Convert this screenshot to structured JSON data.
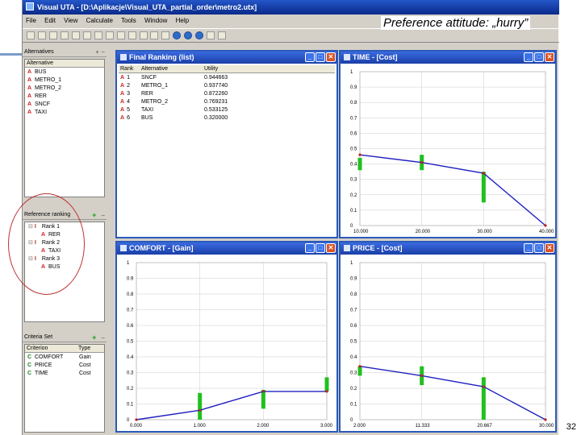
{
  "titlebar": {
    "title": "Visual UTA - [D:\\Aplikacje\\Visual_UTA_partial_order\\metro2.utx]"
  },
  "menu": [
    "File",
    "Edit",
    "View",
    "Calculate",
    "Tools",
    "Window",
    "Help"
  ],
  "overlay": {
    "preference": "Preference attitude: „hurry”",
    "slide_number": "32"
  },
  "alternatives_panel": {
    "title": "Alternatives",
    "column": "Alternative",
    "items": [
      {
        "mark": "A",
        "name": "BUS"
      },
      {
        "mark": "A",
        "name": "METRO_1"
      },
      {
        "mark": "A",
        "name": "METRO_2"
      },
      {
        "mark": "A",
        "name": "RER"
      },
      {
        "mark": "A",
        "name": "SNCF"
      },
      {
        "mark": "A",
        "name": "TAXI"
      }
    ]
  },
  "reference_panel": {
    "title": "Reference ranking",
    "tree": [
      {
        "rank": "Rank 1",
        "items": [
          "RER"
        ]
      },
      {
        "rank": "Rank 2",
        "items": [
          "TAXI"
        ]
      },
      {
        "rank": "Rank 3",
        "items": [
          "BUS"
        ]
      }
    ]
  },
  "criteria_panel": {
    "title": "Criteria Set",
    "columns": [
      "Criterion",
      "Type"
    ],
    "items": [
      {
        "mark": "C",
        "name": "COMFORT",
        "type": "Gain"
      },
      {
        "mark": "C",
        "name": "PRICE",
        "type": "Cost"
      },
      {
        "mark": "C",
        "name": "TIME",
        "type": "Cost"
      }
    ]
  },
  "ranking_window": {
    "title": "Final Ranking (list)",
    "columns": [
      "Rank",
      "Alternative",
      "Utility"
    ],
    "rows": [
      {
        "mark": "A",
        "rank": "1",
        "alt": "SNCF",
        "util": "0.944663"
      },
      {
        "mark": "A",
        "rank": "2",
        "alt": "METRO_1",
        "util": "0.937740"
      },
      {
        "mark": "A",
        "rank": "3",
        "alt": "RER",
        "util": "0.872260"
      },
      {
        "mark": "A",
        "rank": "4",
        "alt": "METRO_2",
        "util": "0.769231"
      },
      {
        "mark": "A",
        "rank": "5",
        "alt": "TAXI",
        "util": "0.533125"
      },
      {
        "mark": "A",
        "rank": "6",
        "alt": "BUS",
        "util": "0.320000"
      }
    ]
  },
  "window_buttons": {
    "minimize": "_",
    "maximize": "□",
    "close": "✕"
  },
  "colors": {
    "line": "#2020c0",
    "bar": "#20c020",
    "point": "#c02020",
    "titlebar": "#1a3fa8"
  },
  "chart_data": [
    {
      "type": "line",
      "title": "TIME - [Cost]",
      "x_ticks": [
        "10.000",
        "20.000",
        "30.000",
        "40.000"
      ],
      "y_ticks": [
        "0",
        "0.1",
        "0.2",
        "0.3",
        "0.4",
        "0.5",
        "0.6",
        "0.7",
        "0.8",
        "0.9",
        "1"
      ],
      "xlim": [
        10,
        40
      ],
      "ylim": [
        0,
        1
      ],
      "points": [
        [
          10,
          0.46
        ],
        [
          20,
          0.41
        ],
        [
          30,
          0.34
        ],
        [
          40,
          0.0
        ]
      ],
      "ranges": [
        [
          10,
          0.36,
          0.44
        ],
        [
          20,
          0.36,
          0.46
        ],
        [
          30,
          0.15,
          0.35
        ]
      ]
    },
    {
      "type": "line",
      "title": "COMFORT - [Gain]",
      "x_ticks": [
        "0.000",
        "1.000",
        "2.000",
        "3.000"
      ],
      "y_ticks": [
        "0",
        "0.1",
        "0.2",
        "0.3",
        "0.4",
        "0.5",
        "0.6",
        "0.7",
        "0.8",
        "0.9",
        "1"
      ],
      "xlim": [
        0,
        3
      ],
      "ylim": [
        0,
        1
      ],
      "points": [
        [
          0,
          0.0
        ],
        [
          1,
          0.06
        ],
        [
          2,
          0.18
        ],
        [
          3,
          0.18
        ]
      ],
      "ranges": [
        [
          1,
          0.0,
          0.17
        ],
        [
          2,
          0.07,
          0.19
        ],
        [
          3,
          0.18,
          0.27
        ]
      ]
    },
    {
      "type": "line",
      "title": "PRICE - [Cost]",
      "x_ticks": [
        "2.000",
        "11.333",
        "20.667",
        "30.000"
      ],
      "y_ticks": [
        "0",
        "0.1",
        "0.2",
        "0.3",
        "0.4",
        "0.5",
        "0.6",
        "0.7",
        "0.8",
        "0.9",
        "1"
      ],
      "xlim": [
        2,
        30
      ],
      "ylim": [
        0,
        1
      ],
      "points": [
        [
          2,
          0.34
        ],
        [
          11.333,
          0.28
        ],
        [
          20.667,
          0.21
        ],
        [
          30,
          0.0
        ]
      ],
      "ranges": [
        [
          2,
          0.28,
          0.34
        ],
        [
          11.333,
          0.22,
          0.34
        ],
        [
          20.667,
          0.0,
          0.27
        ]
      ]
    }
  ]
}
